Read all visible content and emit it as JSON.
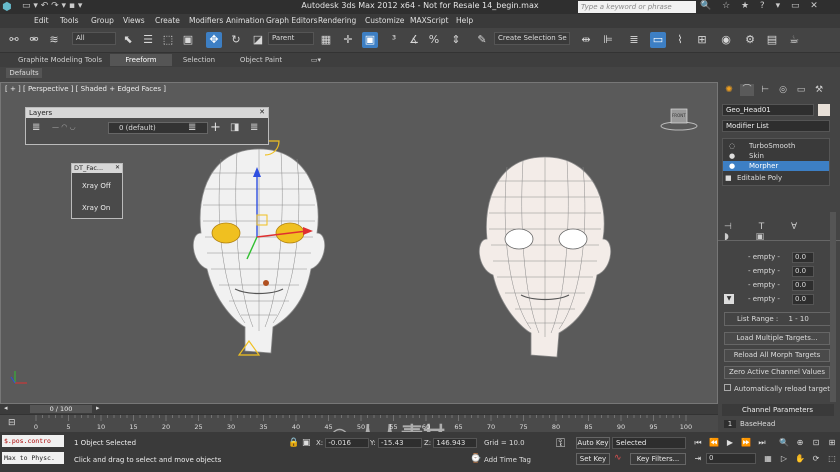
{
  "window": {
    "title": "Autodesk 3ds Max  2012 x64  - Not for Resale    14_begin.max",
    "search_placeholder": "Type a keyword or phrase"
  },
  "menu": [
    "Edit",
    "Tools",
    "Group",
    "Views",
    "Create",
    "Modifiers",
    "Animation",
    "Graph Editors",
    "Rendering",
    "Customize",
    "MAXScript",
    "Help"
  ],
  "toolbar": {
    "selection_filter": "All",
    "coord_system": "Parent",
    "named_selection": "Create Selection Se"
  },
  "ribbon": {
    "tabs": [
      "Graphite Modeling Tools",
      "Freeform",
      "Selection",
      "Object Paint"
    ],
    "active_tab": "Freeform",
    "defaults_label": "Defaults"
  },
  "viewport": {
    "label": "[ + ] [ Perspective ] [ Shaded + Edged Faces ]",
    "layers_title": "Layers",
    "layer_current": "0 (default)",
    "dt_title": "DT_Fac...",
    "xray_off": "Xray Off",
    "xray_on": "Xray On",
    "cube_label": "FRONT"
  },
  "command_panel": {
    "object_name": "Geo_Head01",
    "modifier_list": "Modifier List",
    "stack": [
      {
        "label": "TurboSmooth",
        "selected": false
      },
      {
        "label": "Skin",
        "selected": false
      },
      {
        "label": "Morpher",
        "selected": true
      },
      {
        "label": "Editable Poly",
        "selected": false
      }
    ],
    "channels": [
      {
        "label": "- empty -",
        "value": "0.0"
      },
      {
        "label": "- empty -",
        "value": "0.0"
      },
      {
        "label": "- empty -",
        "value": "0.0"
      },
      {
        "label": "- empty -",
        "value": "0.0"
      }
    ],
    "list_range_label": "List Range :",
    "list_range_value": "1 - 10",
    "load_targets": "Load Multiple Targets...",
    "reload_targets": "Reload All Morph Targets",
    "zero_channels": "Zero Active Channel Values",
    "auto_reload": "Automatically reload targets",
    "channel_params": "Channel Parameters",
    "channel_index": "1",
    "channel_name": "BaseHead"
  },
  "timeline": {
    "frame": "0 / 100",
    "ticks": [
      "0",
      "5",
      "10",
      "15",
      "20",
      "25",
      "30",
      "35",
      "40",
      "45",
      "50",
      "55",
      "60",
      "65",
      "70",
      "75",
      "80",
      "85",
      "90",
      "95",
      "100"
    ]
  },
  "status": {
    "script_line1": "$.pos.contro",
    "script_line2": "Max to Physc.",
    "selection": "1 Object Selected",
    "prompt": "Click and drag to select and move objects",
    "x_label": "X:",
    "x_value": "-0.016",
    "y_label": "Y:",
    "y_value": "-15.43",
    "z_label": "Z:",
    "z_value": "146.943",
    "grid": "Grid = 10.0",
    "add_time_tag": "Add Time Tag",
    "auto_key": "Auto Key",
    "set_key": "Set Key",
    "key_mode": "Selected",
    "key_filters": "Key Filters...",
    "current_frame": "0"
  },
  "colors": {
    "accent": "#3d7fc4",
    "viewport_bg": "#5a5a5a",
    "gizmo_y": "#2f4fe0",
    "gizmo_x": "#e03030",
    "gizmo_z": "#30c030",
    "selection_yellow": "#f0c020"
  }
}
